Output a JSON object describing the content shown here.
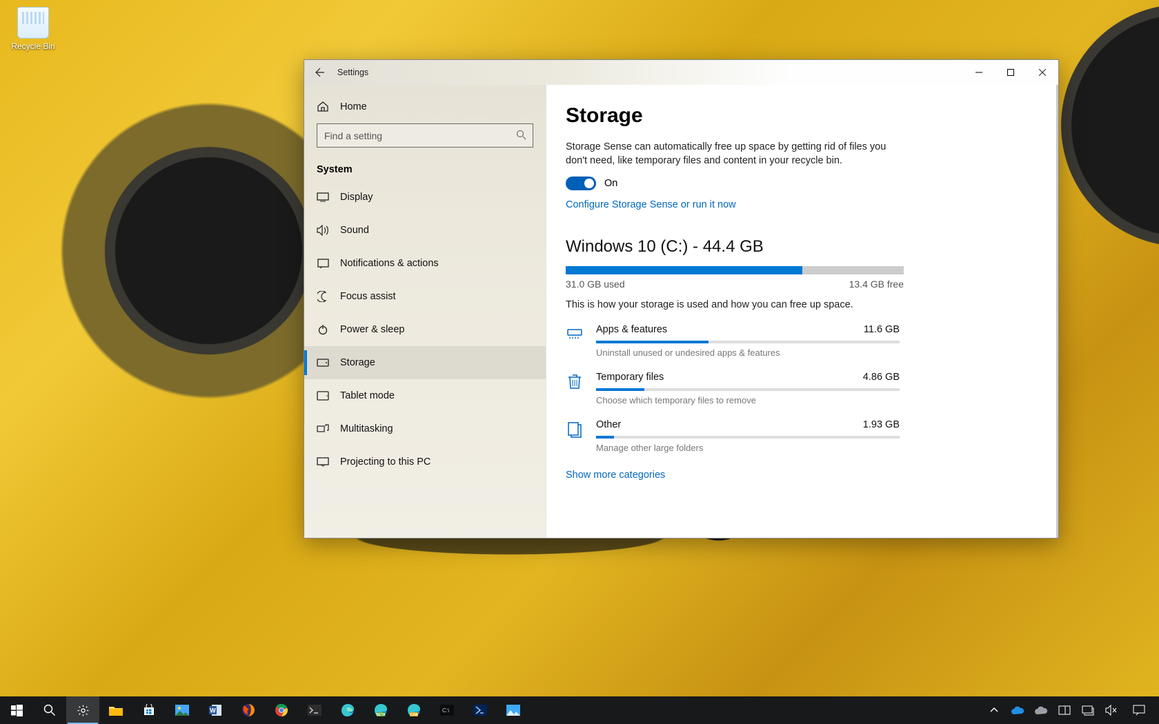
{
  "desktop": {
    "recycle_bin": "Recycle Bin"
  },
  "window": {
    "title": "Settings",
    "home": "Home",
    "search_placeholder": "Find a setting",
    "category": "System",
    "nav": [
      {
        "label": "Display"
      },
      {
        "label": "Sound"
      },
      {
        "label": "Notifications & actions"
      },
      {
        "label": "Focus assist"
      },
      {
        "label": "Power & sleep"
      },
      {
        "label": "Storage"
      },
      {
        "label": "Tablet mode"
      },
      {
        "label": "Multitasking"
      },
      {
        "label": "Projecting to this PC"
      }
    ]
  },
  "content": {
    "page_title": "Storage",
    "sense_desc": "Storage Sense can automatically free up space by getting rid of files you don't need, like temporary files and content in your recycle bin.",
    "toggle_state": "On",
    "configure_link": "Configure Storage Sense or run it now",
    "drive_title": "Windows 10 (C:) - 44.4 GB",
    "used_label": "31.0 GB used",
    "free_label": "13.4 GB free",
    "used_pct": 70,
    "how_used": "This is how your storage is used and how you can free up space.",
    "categories": [
      {
        "name": "Apps & features",
        "size": "11.6 GB",
        "hint": "Uninstall unused or undesired apps & features",
        "pct": 37
      },
      {
        "name": "Temporary files",
        "size": "4.86 GB",
        "hint": "Choose which temporary files to remove",
        "pct": 16
      },
      {
        "name": "Other",
        "size": "1.93 GB",
        "hint": "Manage other large folders",
        "pct": 6
      }
    ],
    "show_more": "Show more categories"
  }
}
